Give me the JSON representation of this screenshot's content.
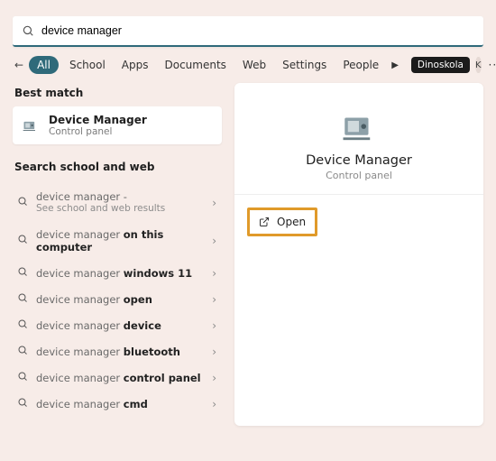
{
  "search": {
    "value": "device manager"
  },
  "filters": {
    "all": "All",
    "school": "School",
    "apps": "Apps",
    "documents": "Documents",
    "web": "Web",
    "settings": "Settings",
    "people": "People",
    "account_label": "Dinoskola",
    "avatar_initial": "K"
  },
  "sections": {
    "best_match": "Best match",
    "search_web": "Search school and web"
  },
  "best_match": {
    "title": "Device Manager",
    "subtitle": "Control panel"
  },
  "results": [
    {
      "prefix": "device manager",
      "rest": " - ",
      "sub": "See school and web results"
    },
    {
      "prefix": "device manager ",
      "bold": "on this computer"
    },
    {
      "prefix": "device manager ",
      "bold": "windows 11"
    },
    {
      "prefix": "device manager ",
      "bold": "open"
    },
    {
      "prefix": "device manager ",
      "bold": "device"
    },
    {
      "prefix": "device manager ",
      "bold": "bluetooth"
    },
    {
      "prefix": "device manager ",
      "bold": "control panel"
    },
    {
      "prefix": "device manager ",
      "bold": "cmd"
    }
  ],
  "detail": {
    "title": "Device Manager",
    "subtitle": "Control panel",
    "open_label": "Open"
  }
}
